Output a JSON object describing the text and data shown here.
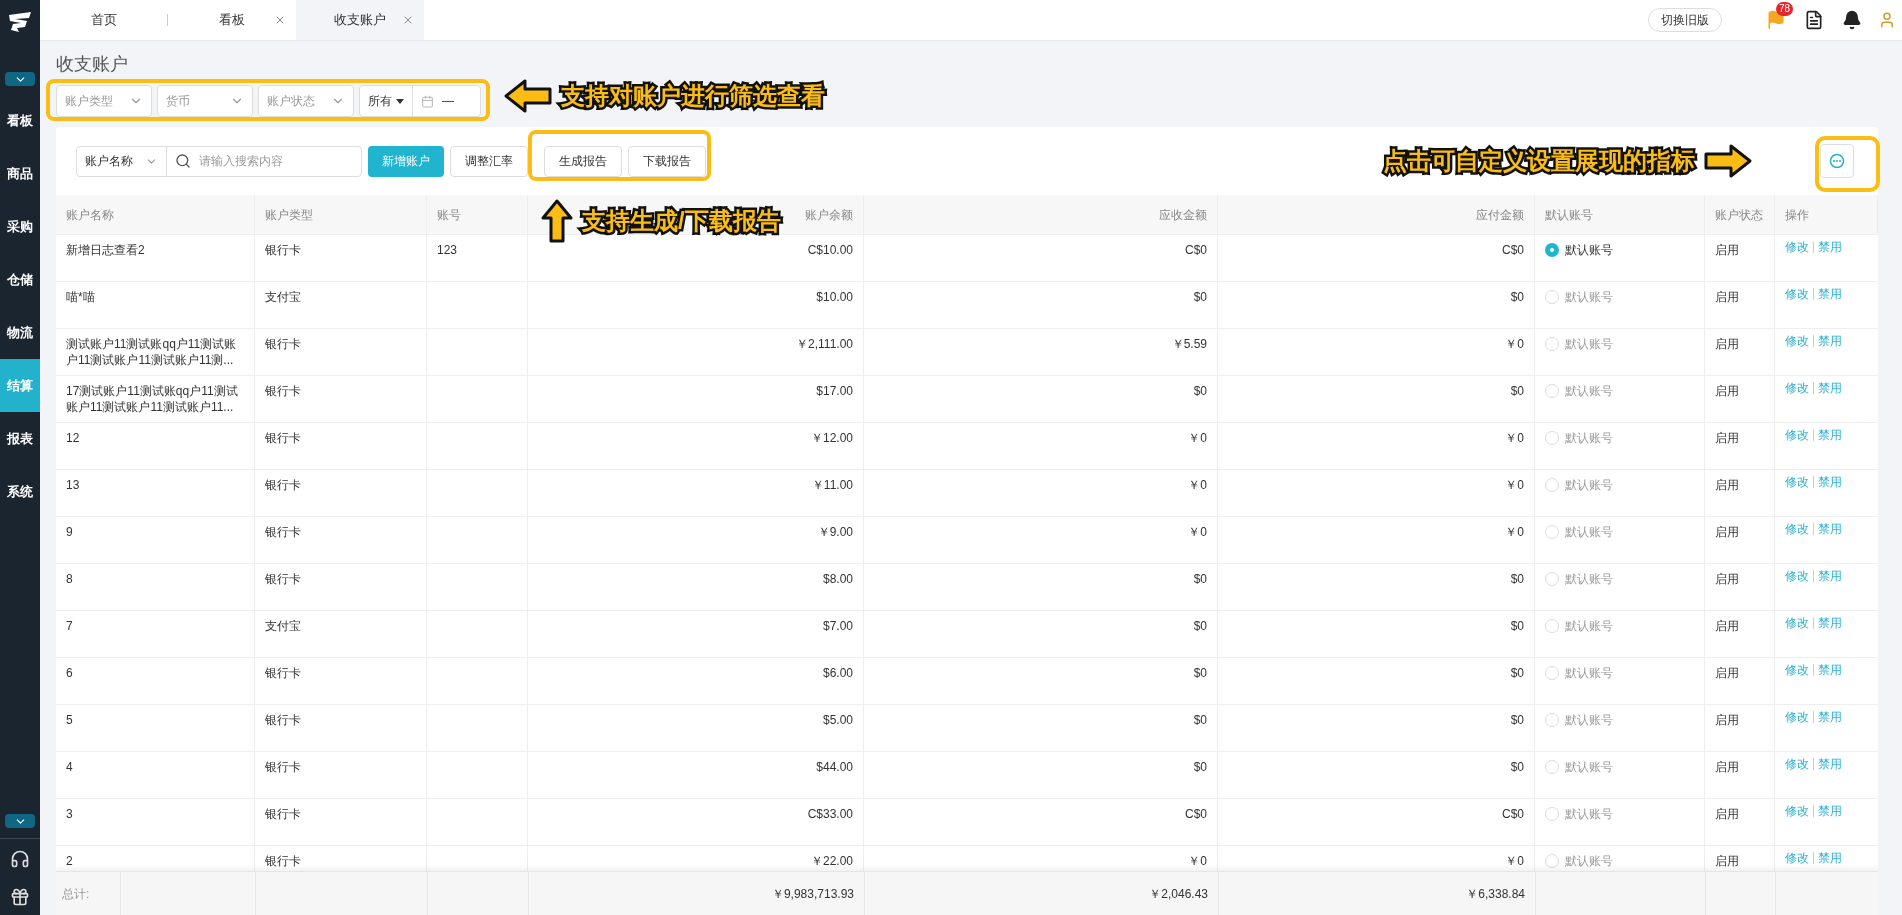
{
  "sidebar": {
    "items": [
      {
        "label": "看板",
        "selected": false
      },
      {
        "label": "商品",
        "selected": false
      },
      {
        "label": "采购",
        "selected": false
      },
      {
        "label": "仓储",
        "selected": false
      },
      {
        "label": "物流",
        "selected": false
      },
      {
        "label": "结算",
        "selected": true
      },
      {
        "label": "报表",
        "selected": false
      },
      {
        "label": "系统",
        "selected": false
      }
    ]
  },
  "tabs": [
    {
      "label": "首页",
      "selected": false,
      "closable": false
    },
    {
      "label": "看板",
      "selected": false,
      "closable": true
    },
    {
      "label": "收支账户",
      "selected": true,
      "closable": true
    }
  ],
  "header": {
    "switch_button": "切换旧版",
    "flag_badge": "78"
  },
  "page_title": "收支账户",
  "filters": [
    {
      "placeholder": "账户类型"
    },
    {
      "placeholder": "货币"
    },
    {
      "placeholder": "账户状态"
    }
  ],
  "date_filter": {
    "scope": "所有",
    "separator": "—"
  },
  "toolbar": {
    "search_by": "账户名称",
    "search_placeholder": "请输入搜索内容",
    "buttons": [
      {
        "label": "新增账户",
        "kind": "primary"
      },
      {
        "label": "调整汇率",
        "kind": "default"
      },
      {
        "label": "生成报告",
        "kind": "default"
      },
      {
        "label": "下载报告",
        "kind": "default"
      }
    ]
  },
  "table": {
    "columns": [
      "账户名称",
      "账户类型",
      "账号",
      "账户余额",
      "应收金额",
      "应付金额",
      "默认账号",
      "账户状态",
      "操作"
    ],
    "rows": [
      {
        "name": "新增日志查看2",
        "type": "银行卡",
        "number": "123",
        "balance": "C$10.00",
        "receivable": "C$0",
        "payable": "C$0",
        "default_label": "默认账号",
        "default": true,
        "status": "启用",
        "actions": [
          "修改",
          "禁用"
        ]
      },
      {
        "name": "喵*喵",
        "type": "支付宝",
        "balance": "$10.00",
        "receivable": "$0",
        "payable": "$0",
        "default_label": "默认账号",
        "default": false,
        "status": "启用",
        "actions": [
          "修改",
          "禁用"
        ]
      },
      {
        "name": "测试账户11测试账qq户11测试账户11测试账户11测试账户11测...",
        "type": "银行卡",
        "balance": "￥2,111.00",
        "receivable": "￥5.59",
        "payable": "￥0",
        "default_label": "默认账号",
        "default": false,
        "status": "启用",
        "actions": [
          "修改",
          "禁用"
        ]
      },
      {
        "name": "17测试账户11测试账qq户11测试账户11测试账户11测试账户11...",
        "type": "银行卡",
        "balance": "$17.00",
        "receivable": "$0",
        "payable": "$0",
        "default_label": "默认账号",
        "default": false,
        "status": "启用",
        "actions": [
          "修改",
          "禁用"
        ]
      },
      {
        "name": "12",
        "type": "银行卡",
        "balance": "￥12.00",
        "receivable": "￥0",
        "payable": "￥0",
        "default_label": "默认账号",
        "default": false,
        "status": "启用",
        "actions": [
          "修改",
          "禁用"
        ]
      },
      {
        "name": "13",
        "type": "银行卡",
        "balance": "￥11.00",
        "receivable": "￥0",
        "payable": "￥0",
        "default_label": "默认账号",
        "default": false,
        "status": "启用",
        "actions": [
          "修改",
          "禁用"
        ]
      },
      {
        "name": "9",
        "type": "银行卡",
        "balance": "￥9.00",
        "receivable": "￥0",
        "payable": "￥0",
        "default_label": "默认账号",
        "default": false,
        "status": "启用",
        "actions": [
          "修改",
          "禁用"
        ]
      },
      {
        "name": "8",
        "type": "银行卡",
        "balance": "$8.00",
        "receivable": "$0",
        "payable": "$0",
        "default_label": "默认账号",
        "default": false,
        "status": "启用",
        "actions": [
          "修改",
          "禁用"
        ]
      },
      {
        "name": "7",
        "type": "支付宝",
        "balance": "$7.00",
        "receivable": "$0",
        "payable": "$0",
        "default_label": "默认账号",
        "default": false,
        "status": "启用",
        "actions": [
          "修改",
          "禁用"
        ]
      },
      {
        "name": "6",
        "type": "银行卡",
        "balance": "$6.00",
        "receivable": "$0",
        "payable": "$0",
        "default_label": "默认账号",
        "default": false,
        "status": "启用",
        "actions": [
          "修改",
          "禁用"
        ]
      },
      {
        "name": "5",
        "type": "银行卡",
        "balance": "$5.00",
        "receivable": "$0",
        "payable": "$0",
        "default_label": "默认账号",
        "default": false,
        "status": "启用",
        "actions": [
          "修改",
          "禁用"
        ]
      },
      {
        "name": "4",
        "type": "银行卡",
        "balance": "$44.00",
        "receivable": "$0",
        "payable": "$0",
        "default_label": "默认账号",
        "default": false,
        "status": "启用",
        "actions": [
          "修改",
          "禁用"
        ]
      },
      {
        "name": "3",
        "type": "银行卡",
        "balance": "C$33.00",
        "receivable": "C$0",
        "payable": "C$0",
        "default_label": "默认账号",
        "default": false,
        "status": "启用",
        "actions": [
          "修改",
          "禁用"
        ]
      },
      {
        "name": "2",
        "type": "银行卡",
        "balance": "￥22.00",
        "receivable": "￥0",
        "payable": "￥0",
        "default_label": "默认账号",
        "default": false,
        "status": "启用",
        "actions": [
          "修改",
          "禁用"
        ]
      }
    ],
    "footer": {
      "label": "总计:",
      "balance": "￥9,983,713.93",
      "receivable": "￥2,046.43",
      "payable": "￥6,338.84"
    }
  },
  "annotations": [
    {
      "text": "支持对账户进行筛选查看",
      "kind": "left"
    },
    {
      "text": "支持生成/下载报告",
      "kind": "up"
    },
    {
      "text": "点击可自定义设置展现的指标",
      "kind": "right"
    }
  ]
}
